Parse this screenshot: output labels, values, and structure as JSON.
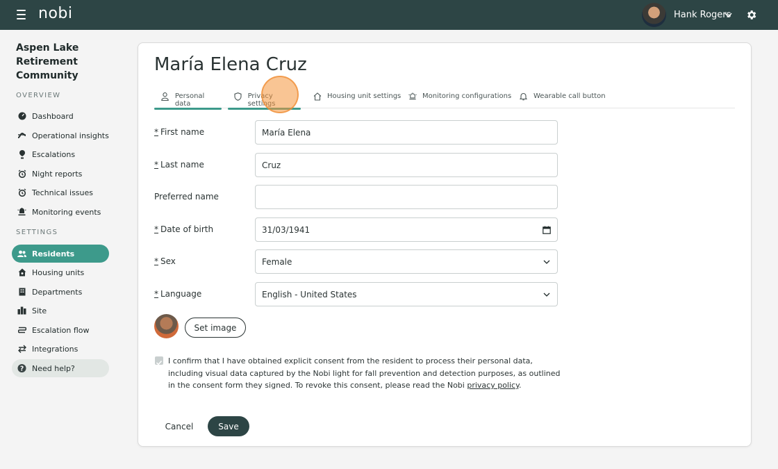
{
  "header": {
    "logo": "nobi",
    "user_name": "Hank Rogers"
  },
  "sidebar": {
    "org_name": "Aspen Lake Retirement Community",
    "overview_label": "OVERVIEW",
    "settings_label": "SETTINGS",
    "overview_items": [
      {
        "label": "Dashboard",
        "icon": "dashboard-icon"
      },
      {
        "label": "Operational insights",
        "icon": "insights-icon"
      },
      {
        "label": "Escalations",
        "icon": "escalation-pin-icon"
      },
      {
        "label": "Night reports",
        "icon": "alarm-clock-icon"
      },
      {
        "label": "Technical issues",
        "icon": "alarm-clock-icon"
      },
      {
        "label": "Monitoring events",
        "icon": "monitoring-icon"
      }
    ],
    "settings_items": [
      {
        "label": "Residents",
        "icon": "users-icon",
        "active": true
      },
      {
        "label": "Housing units",
        "icon": "house-icon"
      },
      {
        "label": "Departments",
        "icon": "building-icon"
      },
      {
        "label": "Site",
        "icon": "site-icon"
      },
      {
        "label": "Escalation flow",
        "icon": "flow-icon"
      },
      {
        "label": "Integrations",
        "icon": "arrows-icon"
      }
    ],
    "help_label": "Need help?"
  },
  "page": {
    "title": "María Elena Cruz",
    "tabs": [
      {
        "label": "Personal data",
        "icon": "person-icon"
      },
      {
        "label": "Privacy settings",
        "icon": "shield-icon"
      },
      {
        "label": "Housing unit settings",
        "icon": "house-icon"
      },
      {
        "label": "Monitoring configurations",
        "icon": "monitoring-icon"
      },
      {
        "label": "Wearable call button",
        "icon": "bell-icon"
      }
    ],
    "required_mark": "*",
    "fields": {
      "first_name": {
        "label": "First name",
        "value": "María Elena"
      },
      "last_name": {
        "label": "Last name",
        "value": "Cruz"
      },
      "preferred_name": {
        "label": "Preferred name",
        "value": ""
      },
      "date_of_birth": {
        "label": "Date of birth",
        "value": "31/03/1941"
      },
      "sex": {
        "label": "Sex",
        "value": "Female"
      },
      "language": {
        "label": "Language",
        "value": "English - United States"
      }
    },
    "set_image_label": "Set image",
    "consent_text": "I confirm that I have obtained explicit consent from the resident to process their personal data, including visual data captured by the Nobi light for fall prevention and detection purposes, as outlined in the consent form they signed. To revoke this consent, please read the Nobi ",
    "consent_link": "privacy policy",
    "consent_end": ".",
    "cancel_label": "Cancel",
    "save_label": "Save"
  }
}
